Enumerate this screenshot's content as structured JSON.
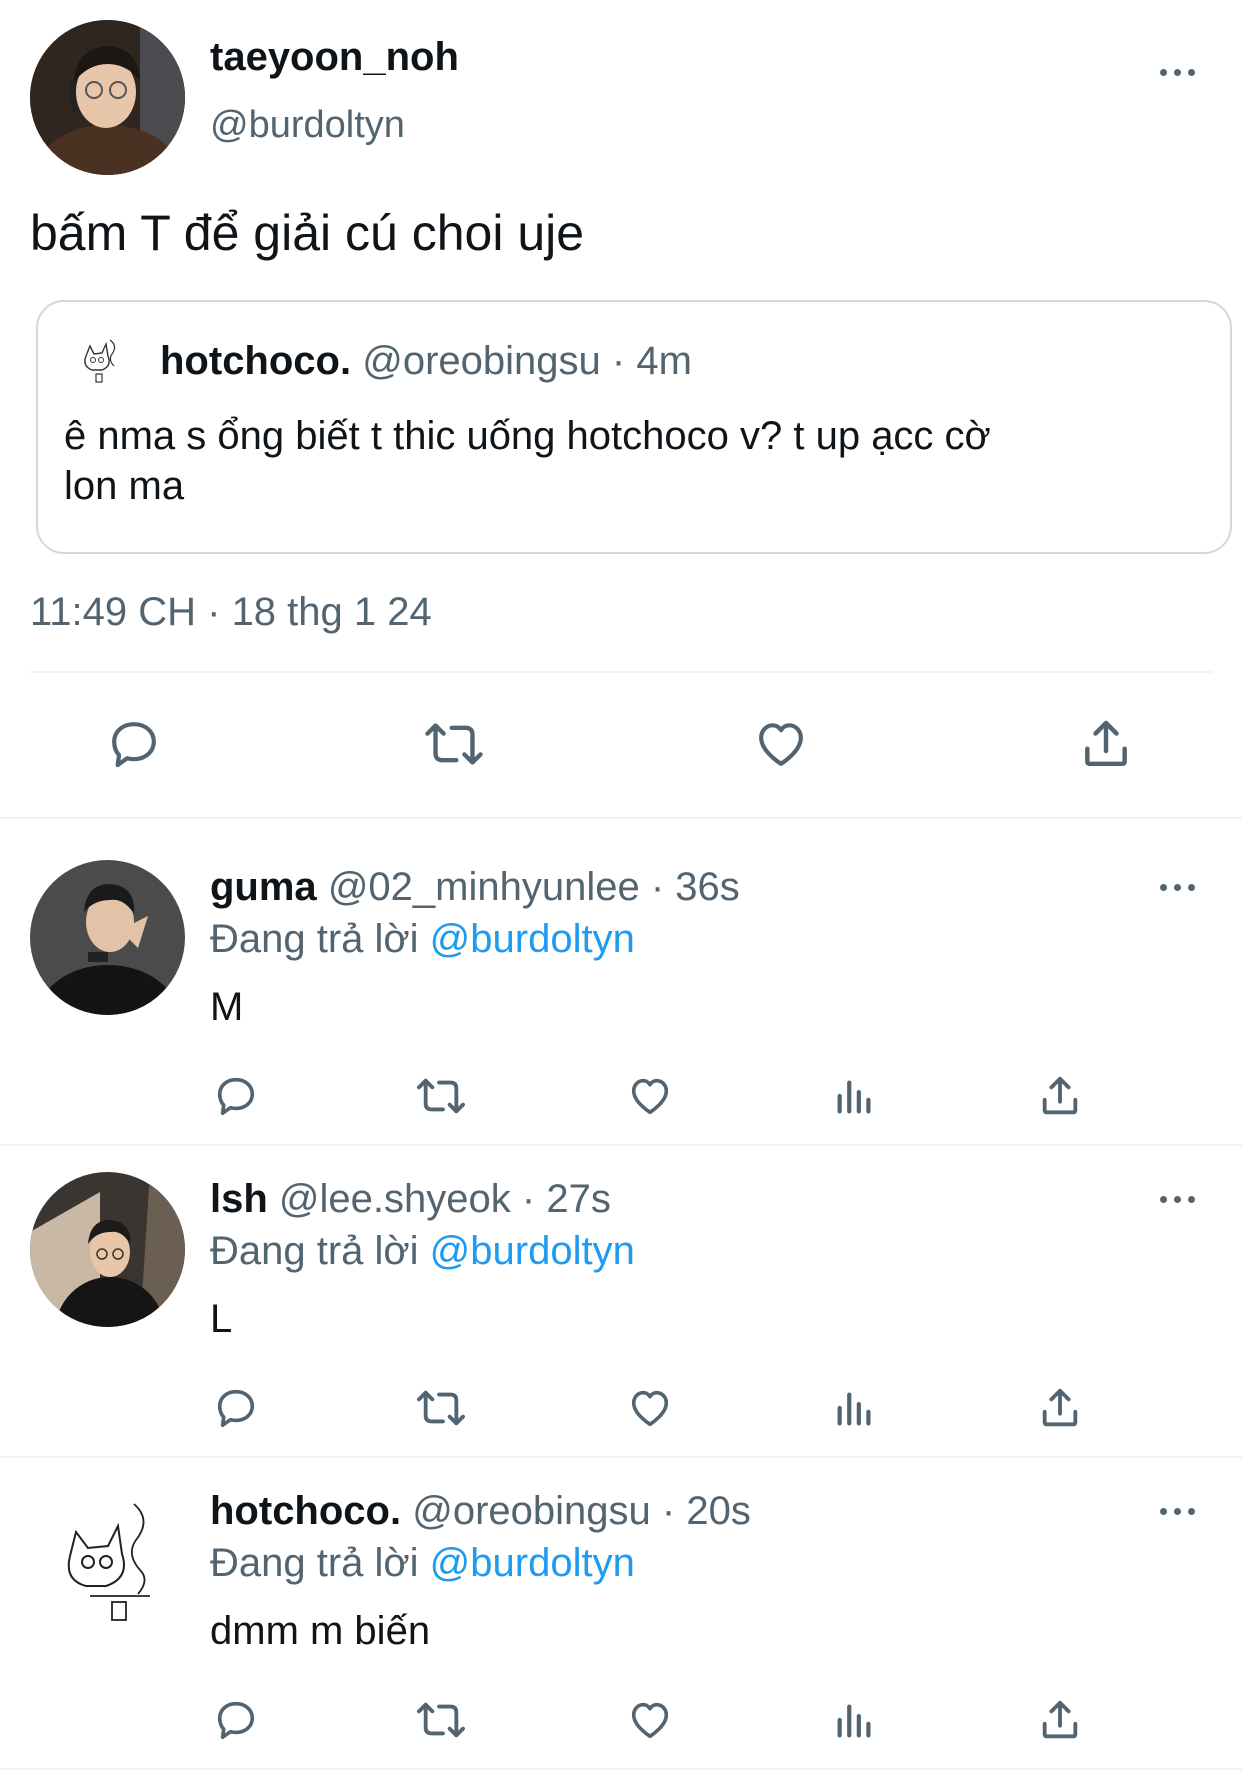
{
  "main_tweet": {
    "display_name": "taeyoon_noh",
    "handle": "@burdoltyn",
    "text": "bấm T để giải cú choi uje",
    "timestamp": "11:49 CH · 18 thg 1 24",
    "quoted": {
      "display_name": "hotchoco.",
      "handle": "@oreobingsu",
      "time": "· 4m",
      "text_line1": "ê nma s ổng biết t thic uống hotchoco v? t up ạcc cờ",
      "text_line2": "lon ma"
    },
    "actions": [
      "reply-icon",
      "retweet-icon",
      "like-icon",
      "share-icon"
    ]
  },
  "replies": [
    {
      "display_name": "guma",
      "handle": "@02_minhyunlee",
      "time": "· 36s",
      "replying_prefix": "Đang trả lời",
      "replying_to": "@burdoltyn",
      "text": "M"
    },
    {
      "display_name": "lsh",
      "handle": "@lee.shyeok",
      "time": "· 27s",
      "replying_prefix": "Đang trả lời",
      "replying_to": "@burdoltyn",
      "text": "L"
    },
    {
      "display_name": "hotchoco.",
      "handle": "@oreobingsu",
      "time": "· 20s",
      "replying_prefix": "Đang trả lời",
      "replying_to": "@burdoltyn",
      "text": "dmm m biến"
    }
  ],
  "colors": {
    "text": "#0f1419",
    "secondary": "#536471",
    "link": "#1d9bf0",
    "divider": "#eff3f4"
  }
}
